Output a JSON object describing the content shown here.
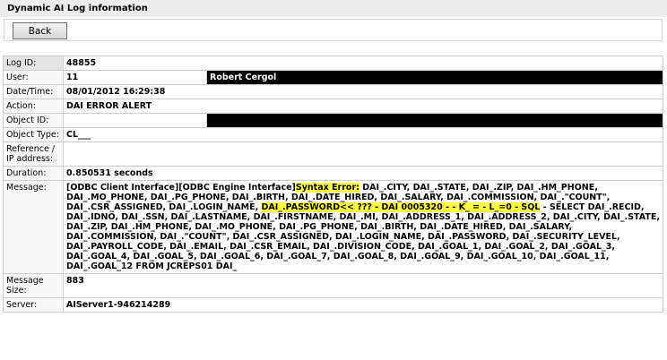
{
  "window": {
    "title": "Dynamic AI Log information"
  },
  "toolbar": {
    "back_label": "Back"
  },
  "rows": {
    "log_id": {
      "label": "Log ID:",
      "value": "48855"
    },
    "user": {
      "label": "User:",
      "value": "11",
      "name": "Robert Cergol"
    },
    "datetime": {
      "label": "Date/Time:",
      "value": "08/01/2012 16:29:38"
    },
    "action": {
      "label": "Action:",
      "value": "DAI ERROR ALERT"
    },
    "object_id": {
      "label": "Object ID:",
      "value": ""
    },
    "object_type": {
      "label": "Object Type:",
      "value": "CL___"
    },
    "reference": {
      "label": "Reference / IP address:",
      "value": ""
    },
    "duration": {
      "label": "Duration:",
      "value": "0.850531 seconds"
    },
    "message": {
      "label": "Message:",
      "part1": "[ODBC Client Interface][ODBC Engine Interface]",
      "part2": "Syntax Error:",
      "part3": " DAI_.CITY, DAI_.STATE, DAI_.ZIP, DAI_.HM_PHONE, DAI_.MO_PHONE, DAI_.PG_PHONE, DAI_.BIRTH, DAI_.DATE_HIRED, DAI_.SALARY, DAI_.COMMISSION, DAI_.\"COUNT\", DAI_.CSR_ASSIGNED, DAI_.LOGIN_NAME, ",
      "part4": "DAI_.PASSWORD<< ??? - DAI 0005320 - - K_ = - L_=0 - SQL",
      "part5": " - SELECT DAI_.RECID, DAI_.IDNO, DAI_.SSN, DAI_.LASTNAME, DAI_.FIRSTNAME, DAI_.MI, DAI_.ADDRESS_1, DAI_.ADDRESS_2, DAI_.CITY, DAI_.STATE, DAI_.ZIP, DAI_.HM_PHONE, DAI_.MO_PHONE, DAI_.PG_PHONE, DAI_.BIRTH, DAI_.DATE_HIRED, DAI_.SALARY, DAI_.COMMISSION, DAI_.\"COUNT\", DAI_.CSR_ASSIGNED, DAI_.LOGIN_NAME, DAI_.PASSWORD, DAI_.SECURITY_LEVEL, DAI_.PAYROLL_CODE, DAI_.EMAIL, DAI_.CSR_EMAIL, DAI_.DIVISION_CODE, DAI_.GOAL_1, DAI_.GOAL_2, DAI_.GOAL_3, DAI_.GOAL_4, DAI_.GOAL_5, DAI_.GOAL_6, DAI_.GOAL_7, DAI_.GOAL_8, DAI_.GOAL_9, DAI_.GOAL_10, DAI_.GOAL_11, DAI_.GOAL_12 FROM JCREPS01 DAI_"
    },
    "message_size": {
      "label": "Message Size:",
      "value": "883"
    },
    "server": {
      "label": "Server:",
      "value": "AIServer1-946214289"
    }
  }
}
